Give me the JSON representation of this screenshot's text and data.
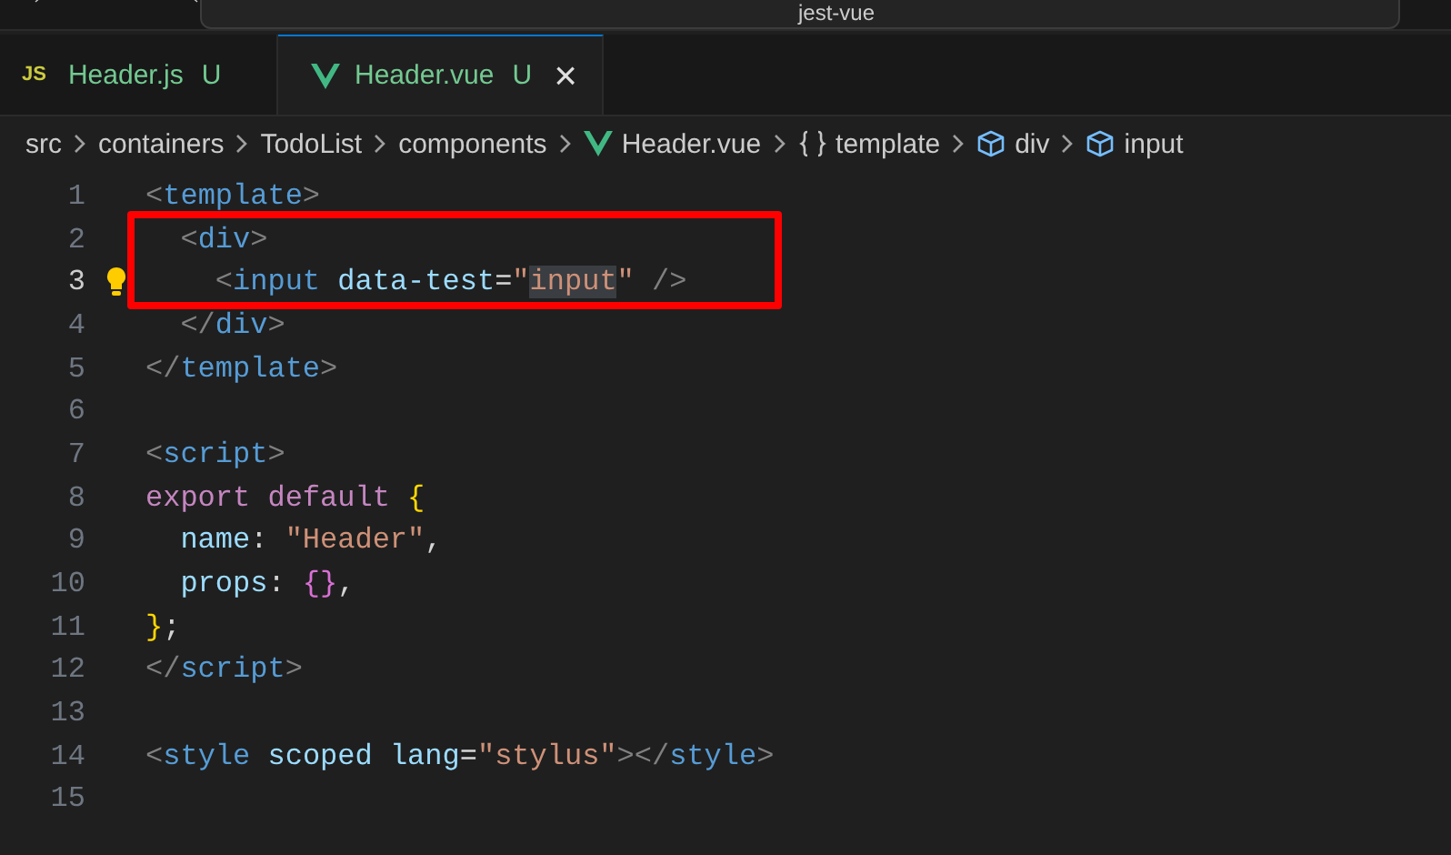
{
  "title_bar": {
    "search_text": "jest-vue"
  },
  "tabs": [
    {
      "label": "Header.js",
      "status": "U",
      "kind": "js",
      "icon_label": "JS",
      "selected": false,
      "closable": false
    },
    {
      "label": "Header.vue",
      "status": "U",
      "kind": "vue",
      "selected": true,
      "closable": true,
      "close_glyph": "×"
    }
  ],
  "breadcrumbs": [
    {
      "label": "src",
      "kind": "path"
    },
    {
      "label": "containers",
      "kind": "path"
    },
    {
      "label": "TodoList",
      "kind": "path"
    },
    {
      "label": "components",
      "kind": "path"
    },
    {
      "label": "Header.vue",
      "kind": "file"
    },
    {
      "label": "template",
      "kind": "section"
    },
    {
      "label": "div",
      "kind": "element"
    },
    {
      "label": "input",
      "kind": "element"
    }
  ],
  "lines": [
    {
      "number": "1",
      "current": false,
      "lightbulb": false,
      "segments": [
        {
          "text": "<template>",
          "highlighted": false
        }
      ]
    },
    {
      "number": "2",
      "current": false,
      "lightbulb": false,
      "segments": [
        {
          "text": "  <div>",
          "highlighted": false
        }
      ]
    },
    {
      "number": "3",
      "current": true,
      "lightbulb": true,
      "segments": [
        {
          "text": "    <input data-test=\"",
          "highlighted": false
        },
        {
          "text": "input",
          "highlighted": true
        },
        {
          "text": "\" />",
          "highlighted": false
        }
      ]
    },
    {
      "number": "4",
      "current": false,
      "lightbulb": false,
      "segments": [
        {
          "text": "  </div>",
          "highlighted": false
        }
      ]
    },
    {
      "number": "5",
      "current": false,
      "lightbulb": false,
      "segments": [
        {
          "text": "</template>",
          "highlighted": false
        }
      ]
    },
    {
      "number": "6",
      "current": false,
      "lightbulb": false
    },
    {
      "number": "7",
      "current": false,
      "lightbulb": false,
      "segments": [
        {
          "text": "<script>",
          "highlighted": false
        }
      ]
    },
    {
      "number": "8",
      "current": false,
      "lightbulb": false,
      "segments": [
        {
          "text": "export default {",
          "highlighted": false
        }
      ]
    },
    {
      "number": "9",
      "current": false,
      "lightbulb": false,
      "segments": [
        {
          "text": "  name: \"Header\",",
          "highlighted": false
        }
      ]
    },
    {
      "number": "10",
      "current": false,
      "lightbulb": false,
      "segments": [
        {
          "text": "  props: {},",
          "highlighted": false
        }
      ]
    },
    {
      "number": "11",
      "current": false,
      "lightbulb": false,
      "segments": [
        {
          "text": "};",
          "highlighted": false
        }
      ]
    },
    {
      "number": "12",
      "current": false,
      "lightbulb": false,
      "segments": [
        {
          "text": "</script>",
          "highlighted": false
        }
      ]
    },
    {
      "number": "13",
      "current": false,
      "lightbulb": false
    },
    {
      "number": "14",
      "current": false,
      "lightbulb": false,
      "segments": [
        {
          "text": "<style scoped lang=\"stylus\"></style>",
          "highlighted": false
        }
      ]
    },
    {
      "number": "15",
      "current": false,
      "lightbulb": false
    }
  ],
  "annotation": {
    "kind": "rectangle",
    "color": "#ff0000"
  }
}
